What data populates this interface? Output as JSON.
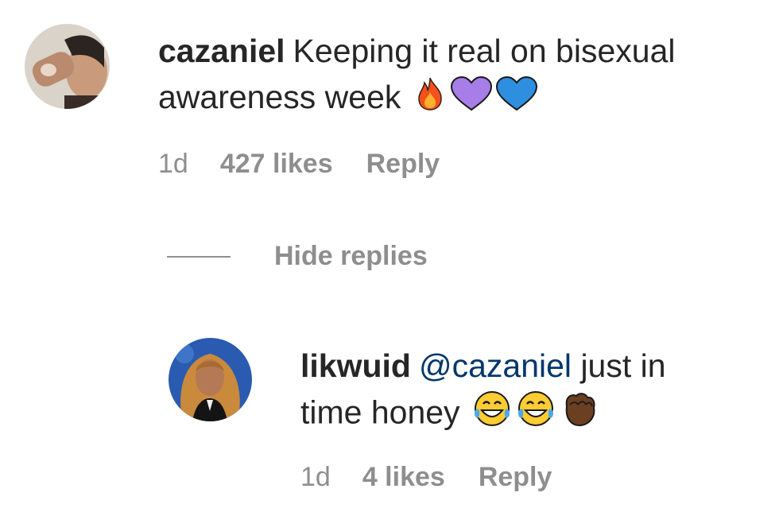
{
  "comment": {
    "username": "cazaniel",
    "text_line1": "Keeping it real on bisexual",
    "text_line2": "awareness week",
    "emojis": [
      "fire-emoji",
      "purple-heart-emoji",
      "blue-heart-emoji"
    ],
    "age": "1d",
    "likes": "427 likes",
    "reply_label": "Reply"
  },
  "thread": {
    "hide_replies_label": "Hide replies"
  },
  "reply": {
    "username": "likwuid",
    "mention": "@cazaniel",
    "text_line1": "just in",
    "text_line2": "time honey",
    "emojis": [
      "tears-of-joy-emoji",
      "tears-of-joy-emoji",
      "raised-fist-emoji"
    ],
    "age": "1d",
    "likes": "4 likes",
    "reply_label": "Reply"
  },
  "colors": {
    "text": "#262626",
    "muted": "#8e8e8e",
    "mention": "#00376b"
  }
}
